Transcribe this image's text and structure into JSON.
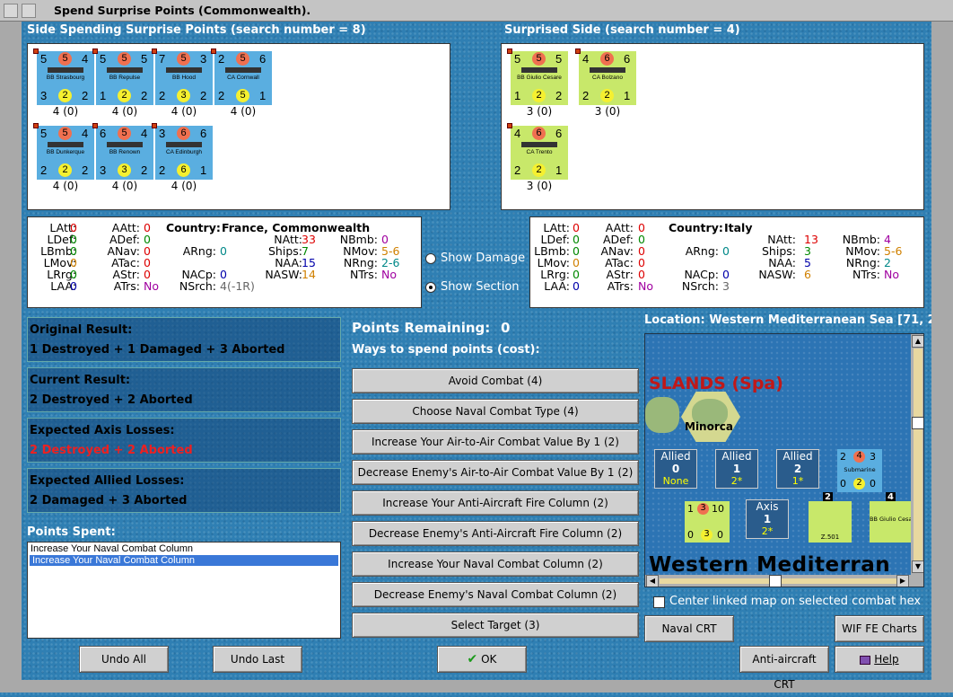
{
  "window": {
    "title": "Spend Surprise Points (Commonwealth)."
  },
  "left_side": {
    "header": "Side Spending Surprise Points (search number = 8)",
    "counters": [
      {
        "name": "BB Strasbourg",
        "tl": "5",
        "tc": "5",
        "tr": "4",
        "bl": "3",
        "bc": "2",
        "br": "2",
        "sub": "4 (0)",
        "color": "blue"
      },
      {
        "name": "BB Repulse",
        "tl": "5",
        "tc": "5",
        "tr": "5",
        "bl": "1",
        "bc": "2",
        "br": "2",
        "sub": "4 (0)",
        "color": "blue"
      },
      {
        "name": "BB Hood",
        "tl": "7",
        "tc": "5",
        "tr": "3",
        "bl": "2",
        "bc": "3",
        "br": "2",
        "sub": "4 (0)",
        "color": "blue"
      },
      {
        "name": "CA Cornwall",
        "tl": "2",
        "tc": "5",
        "tr": "6",
        "bl": "2",
        "bc": "5",
        "br": "1",
        "sub": "4 (0)",
        "color": "blue"
      },
      {
        "name": "BB Dunkerque",
        "tl": "5",
        "tc": "5",
        "tr": "4",
        "bl": "2",
        "bc": "2",
        "br": "2",
        "sub": "4 (0)",
        "color": "blue"
      },
      {
        "name": "BB Renown",
        "tl": "6",
        "tc": "5",
        "tr": "4",
        "bl": "3",
        "bc": "3",
        "br": "2",
        "sub": "4 (0)",
        "color": "blue"
      },
      {
        "name": "CA Edinburgh",
        "tl": "3",
        "tc": "6",
        "tr": "6",
        "bl": "2",
        "bc": "6",
        "br": "1",
        "sub": "4 (0)",
        "color": "blue"
      }
    ],
    "stats": {
      "country_label": "Country:",
      "country": "France, Commonwealth",
      "latt": "0",
      "ldef": "0",
      "lbmb": "0",
      "lmov": "0",
      "lrrg": "0",
      "laa": "0",
      "aatt": "0",
      "adef": "0",
      "anav": "0",
      "atac": "0",
      "astr": "0",
      "atrs": "No",
      "arng": "0",
      "nacp": "0",
      "nsrch": "4(-1R)",
      "ships": "7",
      "naa": "15",
      "nasw": "14",
      "natt": "33",
      "nbmb": "0",
      "nmov": "5-6",
      "nrng": "2-6",
      "ntrs": "No"
    }
  },
  "right_side": {
    "header": "Surprised Side (search number = 4)",
    "counters": [
      {
        "name": "BB Giulio Cesare",
        "tl": "5",
        "tc": "5",
        "tr": "5",
        "bl": "1",
        "bc": "2",
        "br": "2",
        "sub": "3 (0)",
        "color": "green"
      },
      {
        "name": "CA Bolzano",
        "tl": "4",
        "tc": "6",
        "tr": "6",
        "bl": "2",
        "bc": "2",
        "br": "1",
        "sub": "3 (0)",
        "color": "green"
      },
      {
        "name": "CA Trento",
        "tl": "4",
        "tc": "6",
        "tr": "6",
        "bl": "2",
        "bc": "2",
        "br": "1",
        "sub": "3 (0)",
        "color": "green"
      }
    ],
    "stats": {
      "country_label": "Country:",
      "country": "Italy",
      "latt": "0",
      "ldef": "0",
      "lbmb": "0",
      "lmov": "0",
      "lrrg": "0",
      "laa": "0",
      "aatt": "0",
      "adef": "0",
      "anav": "0",
      "atac": "0",
      "astr": "0",
      "atrs": "No",
      "arng": "0",
      "nacp": "0",
      "nsrch": "3",
      "ships": "3",
      "naa": "5",
      "nasw": "6",
      "natt": "13",
      "nbmb": "4",
      "nmov": "5-6",
      "nrng": "2",
      "ntrs": "No"
    }
  },
  "labels": {
    "latt": "LAtt:",
    "ldef": "LDef:",
    "lbmb": "LBmb:",
    "lmov": "LMov:",
    "lrrg": "LRrg:",
    "laa": "LAA:",
    "aatt": "AAtt:",
    "adef": "ADef:",
    "anav": "ANav:",
    "atac": "ATac:",
    "astr": "AStr:",
    "atrs": "ATrs:",
    "arng": "ARng:",
    "nacp": "NACp:",
    "nsrch": "NSrch:",
    "ships": "Ships:",
    "naa": "NAA:",
    "nasw": "NASW:",
    "natt": "NAtt:",
    "nbmb": "NBmb:",
    "nmov": "NMov:",
    "nrng": "NRng:",
    "ntrs": "NTrs:"
  },
  "options": {
    "show_damage": "Show Damage",
    "show_section": "Show Section"
  },
  "results": {
    "original_title": "Original Result:",
    "original": "1 Destroyed + 1 Damaged + 3 Aborted",
    "current_title": "Current Result:",
    "current": "2 Destroyed + 2 Aborted",
    "axis_title": "Expected Axis Losses:",
    "axis": "2 Destroyed + 2 Aborted",
    "allied_title": "Expected Allied Losses:",
    "allied": "2 Damaged + 3 Aborted"
  },
  "points_spent": {
    "title": "Points Spent:",
    "items": [
      "Increase Your Naval Combat Column",
      "Increase Your Naval Combat Column"
    ]
  },
  "points": {
    "remaining_label": "Points Remaining:",
    "remaining": "0",
    "ways": "Ways to spend points (cost):"
  },
  "spend_buttons": [
    "Avoid Combat (4)",
    "Choose Naval Combat Type (4)",
    "Increase Your Air-to-Air Combat Value By 1 (2)",
    "Decrease Enemy's Air-to-Air Combat Value By 1 (2)",
    "Increase Your Anti-Aircraft Fire Column (2)",
    "Decrease Enemy's Anti-Aircraft Fire Column (2)",
    "Increase Your Naval Combat Column (2)",
    "Decrease Enemy's Naval Combat Column (2)",
    "Select Target (3)"
  ],
  "map": {
    "location": "Location: Western Mediterranean Sea [71, 2",
    "islands": "SLANDS (Spa)",
    "minorca": "Minorca",
    "sea": "Western Mediterran",
    "boxes": [
      {
        "t": "Allied",
        "n": "0",
        "s": "None"
      },
      {
        "t": "Allied",
        "n": "1",
        "s": "2*"
      },
      {
        "t": "Allied",
        "n": "2",
        "s": "1*"
      },
      {
        "t": "Axis",
        "n": "1",
        "s": "2*"
      }
    ],
    "submarine": "Submarine",
    "z501": "Z.501",
    "giulio": "BB Giulio Cesa",
    "num2": "2",
    "num4": "4"
  },
  "center_linked": "Center linked map on selected combat hex",
  "buttons": {
    "naval_crt": "Naval CRT",
    "wif_charts": "WIF FE Charts",
    "aa_crt": "Anti-aircraft CRT",
    "help": "Help",
    "undo_all": "Undo All",
    "undo_last": "Undo Last",
    "ok": "OK"
  },
  "colors": {
    "loss_red": "#ee2020",
    "stat_red": "#d00000"
  }
}
